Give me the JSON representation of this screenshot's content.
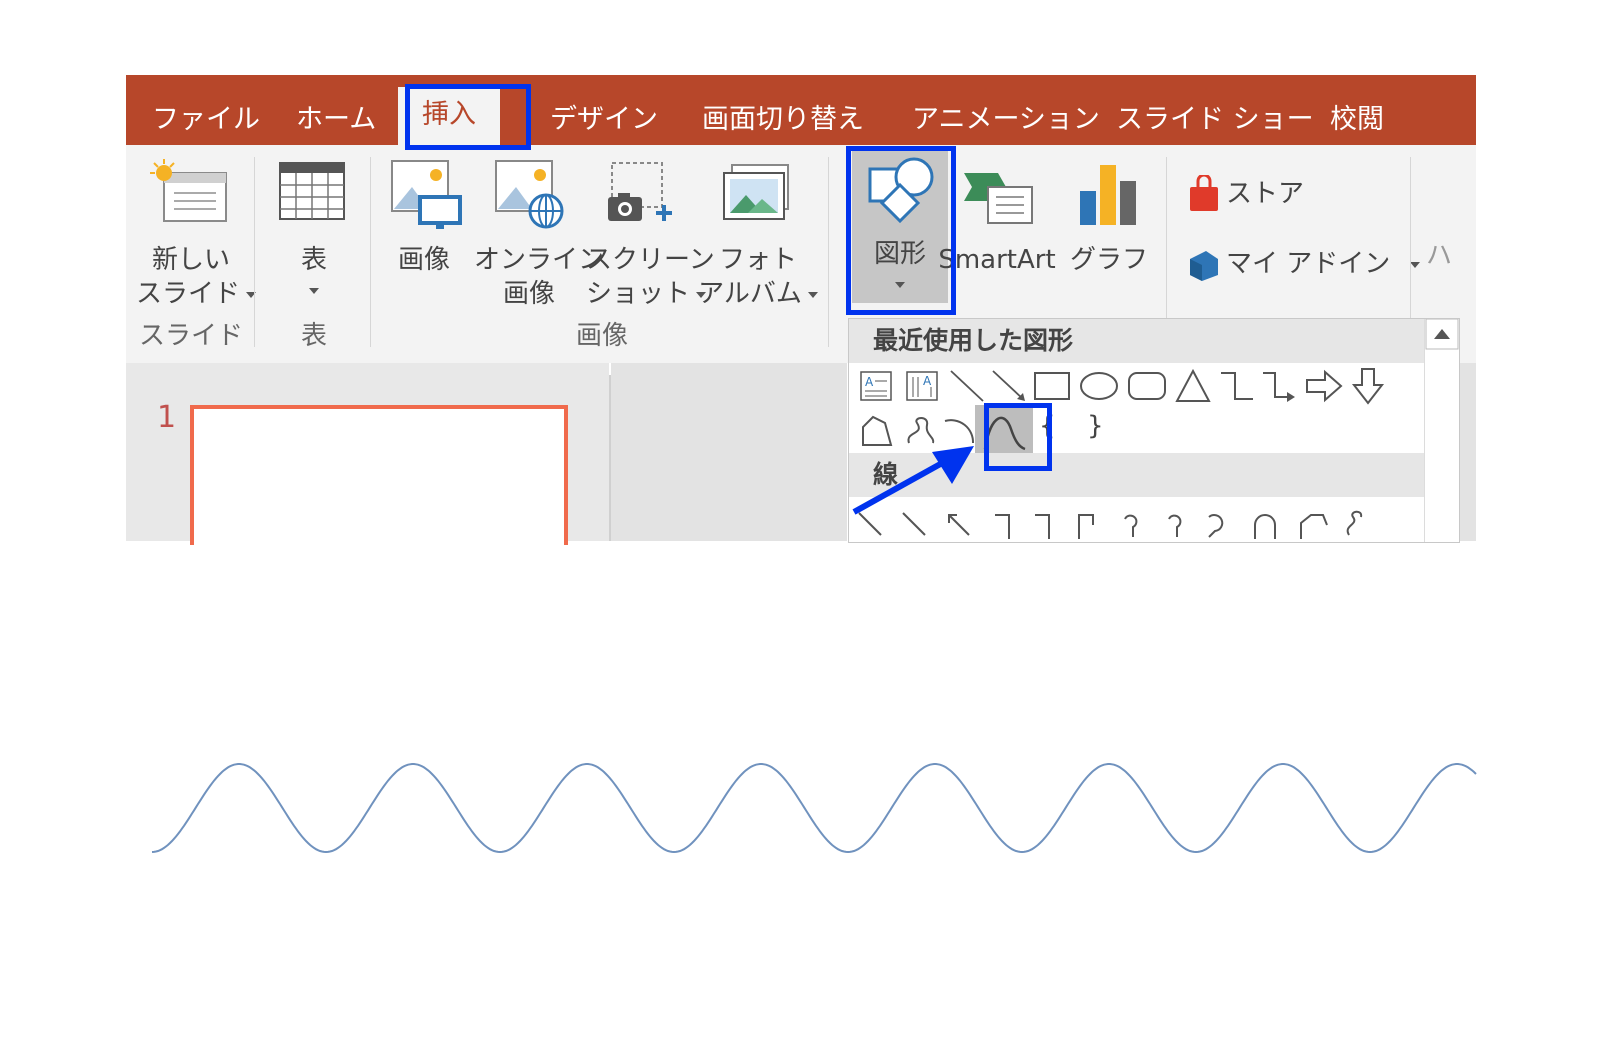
{
  "tabs": [
    "ファイル",
    "ホーム",
    "挿入",
    "デザイン",
    "画面切り替え",
    "アニメーション",
    "スライド ショー",
    "校閲"
  ],
  "active_tab": "挿入",
  "ribbon": {
    "new_slide": [
      "新しい",
      "スライド"
    ],
    "table": "表",
    "image": "画像",
    "online_image": [
      "オンライン",
      "画像"
    ],
    "screenshot": [
      "スクリーン",
      "ショット"
    ],
    "photo_album": [
      "フォト",
      "アルバム"
    ],
    "shapes": "図形",
    "smartart": "SmartArt",
    "graph": "グラフ",
    "store": "ストア",
    "my_addins": "マイ アドイン",
    "cutoff": "ハ",
    "groups": {
      "slide": "スライド",
      "table": "表",
      "image": "画像"
    }
  },
  "dropdown": {
    "recent_header": "最近使用した図形",
    "lines_header": "線",
    "brace_open": "{",
    "brace_close": "}"
  },
  "slide_number": "1",
  "colors": {
    "tab_bar": "#b7472a",
    "highlight": "#0033ee",
    "wave": "#7092be",
    "slide_border": "#f06a4c"
  }
}
